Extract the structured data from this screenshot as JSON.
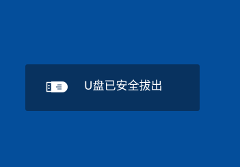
{
  "notification": {
    "icon": "usb-drive-icon",
    "message": "U盘已安全拔出"
  }
}
